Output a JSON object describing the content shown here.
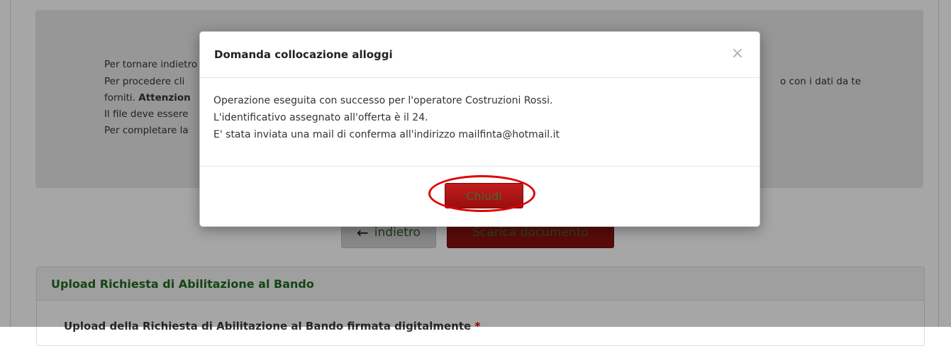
{
  "info": {
    "line1": "Per tornare indietro",
    "line2a": "Per procedere cli",
    "line2b": "o con i dati da te",
    "line3a": "forniti. ",
    "line3b": "Attenzion",
    "line4": "Il file deve essere",
    "line5": "Per completare la"
  },
  "buttons": {
    "back_label": "indietro",
    "download_label": "Scarica documento"
  },
  "upload": {
    "header": "Upload Richiesta di Abilitazione al Bando",
    "sub": "Upload della Richiesta di Abilitazione al Bando firmata digitalmente",
    "required": "*"
  },
  "modal": {
    "title": "Domanda collocazione alloggi",
    "close_glyph": "×",
    "line1": "Operazione eseguita con successo per l'operatore Costruzioni Rossi.",
    "line2": "L'identificativo assegnato all'offerta è il 24.",
    "line3": "E' stata inviata una mail di conferma all'indirizzo mailfinta@hotmail.it",
    "close_button": "Chiudi"
  },
  "colors": {
    "accent_red": "#9a0f0f",
    "highlight": "#e00000",
    "header_green": "#1e6b1e"
  }
}
